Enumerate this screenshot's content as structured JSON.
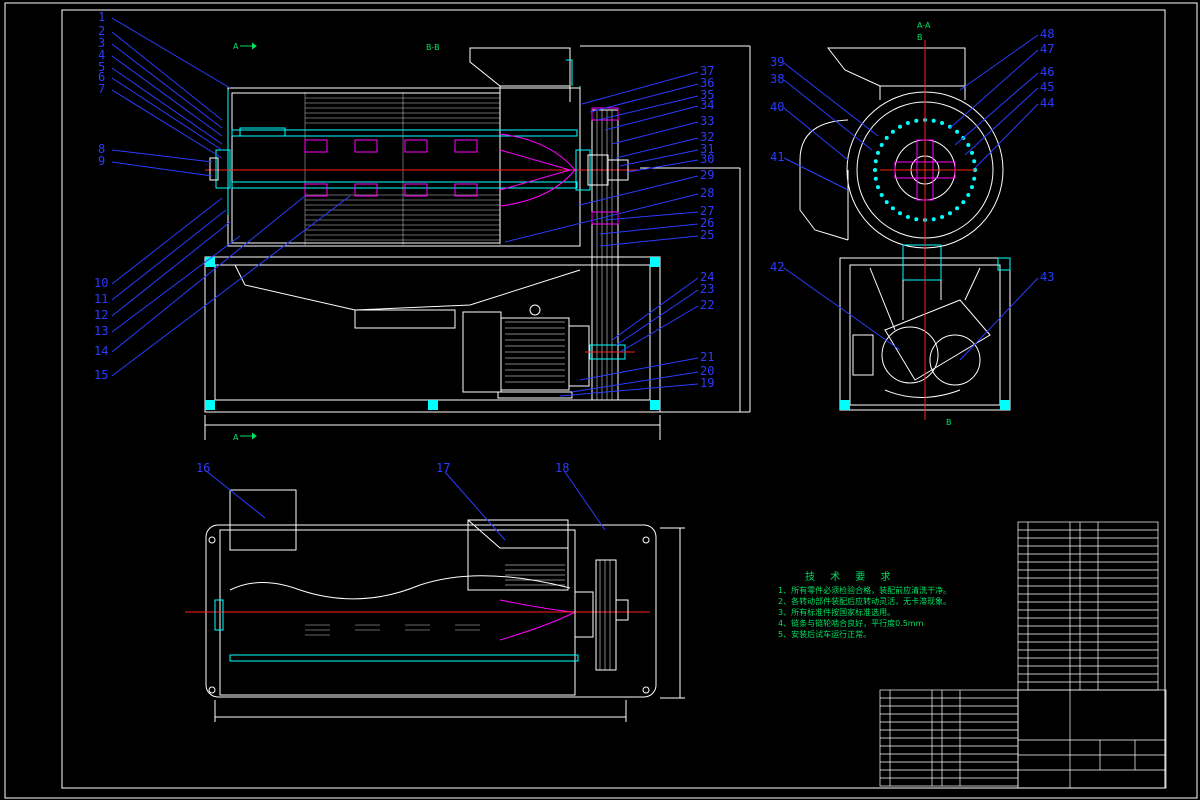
{
  "section_marks": {
    "a_top": "A",
    "a_bottom": "A",
    "bb": "B-B",
    "aa": "A-A",
    "b_top": "B",
    "b_bottom": "B"
  },
  "part_labels_left": [
    "1",
    "2",
    "3",
    "4",
    "5",
    "6",
    "7",
    "8",
    "9",
    "10",
    "11",
    "12",
    "13",
    "14",
    "15"
  ],
  "part_labels_mid": [
    "37",
    "36",
    "35",
    "34",
    "33",
    "32",
    "31",
    "30",
    "29",
    "28",
    "27",
    "26",
    "25",
    "24",
    "23",
    "22",
    "21",
    "20",
    "19"
  ],
  "part_labels_right": [
    "39",
    "38",
    "40",
    "41",
    "42",
    "48",
    "47",
    "46",
    "45",
    "44",
    "43"
  ],
  "part_labels_plan": [
    "16",
    "17",
    "18"
  ],
  "technical_notes": {
    "title": "技 术 要 求",
    "items": [
      "1、所有零件必须检验合格，装配前应清洗干净。",
      "2、各转动部件装配后应转动灵活，无卡滞现象。",
      "3、所有标准件按国家标准选用。",
      "4、链条与链轮啮合良好，平行度0.5mm",
      "5、安装后试车运行正常。"
    ]
  },
  "colors": {
    "background": "#000000",
    "outline": "#ffffff",
    "section": "#00ffff",
    "rotor": "#ff00ff",
    "centerline": "#ff2020",
    "leader": "#2a3cff",
    "notes": "#00e060"
  }
}
